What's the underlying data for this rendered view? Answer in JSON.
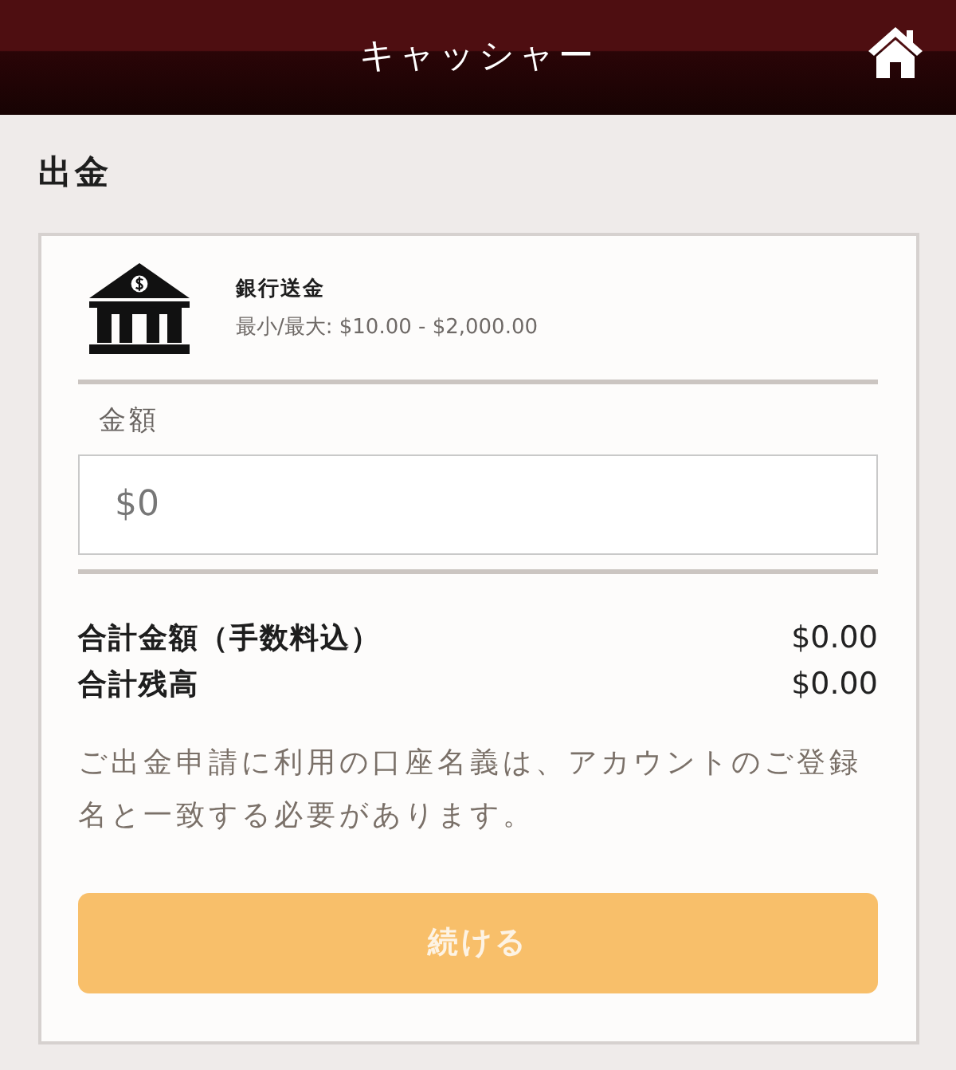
{
  "header": {
    "title": "キャッシャー"
  },
  "page": {
    "title": "出金"
  },
  "method": {
    "name": "銀行送金",
    "limits": "最小/最大: $10.00 - $2,000.00"
  },
  "amount": {
    "label": "金額",
    "placeholder": "$0"
  },
  "totals": [
    {
      "label": "合計金額（手数料込）",
      "value": "$0.00"
    },
    {
      "label": "合計残高",
      "value": "$0.00"
    }
  ],
  "note": "ご出金申請に利用の口座名義は、アカウントのご登録名と一致する必要があります。",
  "continue_button": {
    "label": "続ける",
    "disabled": true
  }
}
